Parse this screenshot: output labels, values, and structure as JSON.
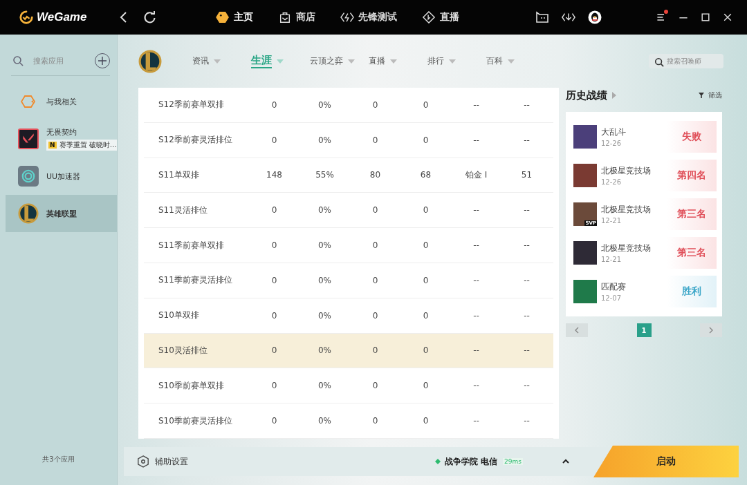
{
  "app": {
    "logo_text": "WeGame"
  },
  "top_nav": [
    {
      "label": "主页",
      "selected": true
    },
    {
      "label": "商店",
      "selected": false
    },
    {
      "label": "先锋测试",
      "selected": false
    },
    {
      "label": "直播",
      "selected": false
    }
  ],
  "sidebar": {
    "search": {
      "placeholder": "搜索应用"
    },
    "items": [
      {
        "label": "与我相关",
        "selected": false
      },
      {
        "label": "无畏契约",
        "badge": "N",
        "notice": "赛季重置 破晓时…",
        "selected": false
      },
      {
        "label": "UU加速器",
        "selected": false
      },
      {
        "label": "英雄联盟",
        "selected": true
      }
    ],
    "footer": "共3个应用"
  },
  "sub_nav": [
    {
      "label": "资讯",
      "selected": false
    },
    {
      "label": "生涯",
      "selected": true
    },
    {
      "label": "云顶之弈",
      "selected": false
    },
    {
      "label": "直播",
      "selected": false
    },
    {
      "label": "排行",
      "selected": false
    },
    {
      "label": "百科",
      "selected": false
    }
  ],
  "summoner_search": {
    "placeholder": "搜索召唤师"
  },
  "table": {
    "rows": [
      {
        "cells": [
          "S12季前赛单双排",
          "0",
          "0%",
          "0",
          "0",
          "--",
          "--"
        ],
        "selected": false
      },
      {
        "cells": [
          "S12季前赛灵活排位",
          "0",
          "0%",
          "0",
          "0",
          "--",
          "--"
        ],
        "selected": false
      },
      {
        "cells": [
          "S11单双排",
          "148",
          "55%",
          "80",
          "68",
          "铂金 Ⅰ",
          "51"
        ],
        "selected": false
      },
      {
        "cells": [
          "S11灵活排位",
          "0",
          "0%",
          "0",
          "0",
          "--",
          "--"
        ],
        "selected": false
      },
      {
        "cells": [
          "S11季前赛单双排",
          "0",
          "0%",
          "0",
          "0",
          "--",
          "--"
        ],
        "selected": false
      },
      {
        "cells": [
          "S11季前赛灵活排位",
          "0",
          "0%",
          "0",
          "0",
          "--",
          "--"
        ],
        "selected": false
      },
      {
        "cells": [
          "S10单双排",
          "0",
          "0%",
          "0",
          "0",
          "--",
          "--"
        ],
        "selected": false
      },
      {
        "cells": [
          "S10灵活排位",
          "0",
          "0%",
          "0",
          "0",
          "--",
          "--"
        ],
        "selected": true
      },
      {
        "cells": [
          "S10季前赛单双排",
          "0",
          "0%",
          "0",
          "0",
          "--",
          "--"
        ],
        "selected": false
      },
      {
        "cells": [
          "S10季前赛灵活排位",
          "0",
          "0%",
          "0",
          "0",
          "--",
          "--"
        ],
        "selected": false
      }
    ]
  },
  "history": {
    "title": "历史战绩",
    "filter": "筛选",
    "matches": [
      {
        "mode": "大乱斗",
        "date": "12-26",
        "result": "失败",
        "kind": "loss"
      },
      {
        "mode": "北极星竞技场",
        "date": "12-26",
        "result": "第四名",
        "kind": "loss"
      },
      {
        "mode": "北极星竞技场",
        "date": "12-21",
        "result": "第三名",
        "kind": "loss",
        "tag": "SVP"
      },
      {
        "mode": "北极星竞技场",
        "date": "12-21",
        "result": "第三名",
        "kind": "loss"
      },
      {
        "mode": "匹配赛",
        "date": "12-07",
        "result": "胜利",
        "kind": "win"
      }
    ],
    "pages": [
      {
        "label": "1",
        "selected": true
      }
    ]
  },
  "bottom_bar": {
    "assist": "辅助设置",
    "server": "战争学院 电信",
    "ping": "29ms",
    "launch": "启动"
  }
}
